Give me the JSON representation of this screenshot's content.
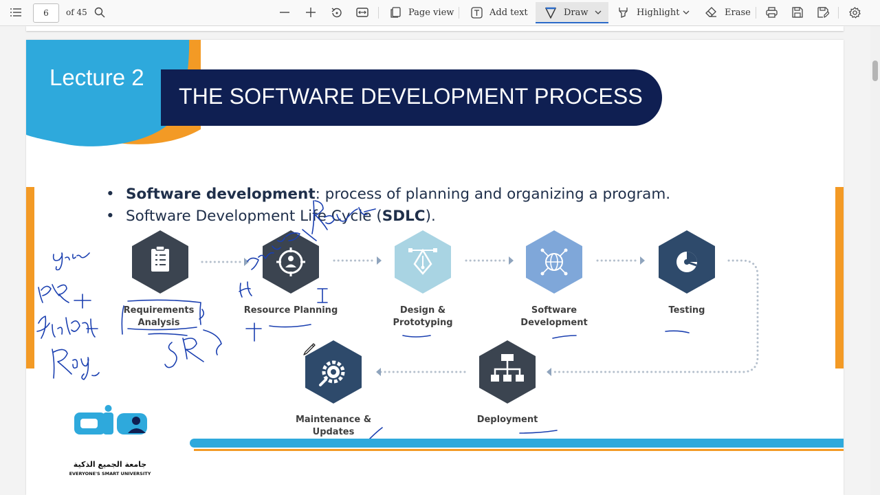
{
  "toolbar": {
    "page_number": "6",
    "page_count": "of 45",
    "page_view_label": "Page view",
    "add_text_label": "Add text",
    "draw_label": "Draw",
    "highlight_label": "Highlight",
    "erase_label": "Erase",
    "icons": [
      "contents-icon",
      "search-icon",
      "zoom-out-icon",
      "zoom-in-icon",
      "rotate-icon",
      "fit-width-icon",
      "page-view-icon",
      "add-text-icon",
      "draw-icon",
      "highlight-icon",
      "erase-icon",
      "print-icon",
      "save-icon",
      "save-as-icon",
      "settings-icon"
    ]
  },
  "slide": {
    "lecture_label": "Lecture 2",
    "title": "THE SOFTWARE DEVELOPMENT PROCESS",
    "bullets": [
      {
        "bold": "Software development",
        "rest": ": process of planning and organizing a program."
      },
      {
        "pre": "Software Development Life Cycle (",
        "bold": "SDLC",
        "post": ")."
      }
    ],
    "steps": [
      {
        "line1": "Requirements",
        "line2": "Analysis",
        "icon": "clipboard-checklist-icon",
        "color": "#3b4450"
      },
      {
        "line1": "Resource Planning",
        "line2": "",
        "icon": "target-person-icon",
        "color": "#3b4450"
      },
      {
        "line1": "Design &",
        "line2": "Prototyping",
        "icon": "pen-tool-icon",
        "color": "#a9d4e3"
      },
      {
        "line1": "Software",
        "line2": "Development",
        "icon": "network-globe-icon",
        "color": "#7fa7d9"
      },
      {
        "line1": "Testing",
        "line2": "",
        "icon": "pie-gear-icon",
        "color": "#2e4a6b"
      },
      {
        "line1": "Deployment",
        "line2": "",
        "icon": "hierarchy-code-icon",
        "color": "#3b4450"
      },
      {
        "line1": "Maintenance &",
        "line2": "Updates",
        "icon": "wrench-gear-icon",
        "color": "#2e4a6b"
      }
    ],
    "logo_arabic": "جامعة الجميع الذكية",
    "logo_english": "EVERYONE'S SMART UNIVERSITY",
    "colors": {
      "navy": "#0f1f52",
      "cyan": "#2ea9dc",
      "orange": "#f39a25",
      "ink": "#1a3fb0"
    }
  }
}
